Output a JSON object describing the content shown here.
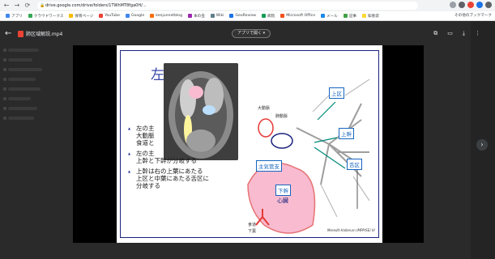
{
  "browser": {
    "url": "drive.google.com/drive/folders/1TWhMT8fga0H/…",
    "bookmarks": [
      "アプリ",
      "クラウドワークス",
      "保育ページ",
      "YouTube",
      "Google",
      "kenjunnetblog",
      "本の虫",
      "Wiki",
      "GeoReview",
      "病院",
      "Microsoft Office",
      "メール",
      "記事",
      "知恵袋"
    ],
    "bookmarks_right": "その他のブックマーク"
  },
  "viewer": {
    "file_name": "肺区域解説.mp4",
    "open_with": "アプリで開く ▾",
    "back_icon": "arrow-left-icon",
    "actions": [
      "add-to-drive-icon",
      "comment-icon",
      "download-icon",
      "more-vert-icon"
    ]
  },
  "slide": {
    "title_letter": "左",
    "bullets": [
      [
        "左の主",
        "大動脈",
        "食道と"
      ],
      [
        "左の主",
        "上幹と下幹が分岐する"
      ],
      [
        "上幹は右の上葉にあたる",
        "上区と中葉にあたる舌区に",
        "分岐する"
      ]
    ],
    "labels": {
      "aorta": "大動脈",
      "pulmonary_artery": "肺動脈",
      "upper_division": "上区",
      "upper_trunk": "上幹",
      "lingula": "舌区",
      "main_bronchus": "主気管支",
      "lower_trunk": "下幹",
      "heart": "心臓",
      "esophagus": "食道",
      "lower_lobe": "下葉",
      "caption": "Meredit Hallerum (MPP/SE) III"
    }
  }
}
